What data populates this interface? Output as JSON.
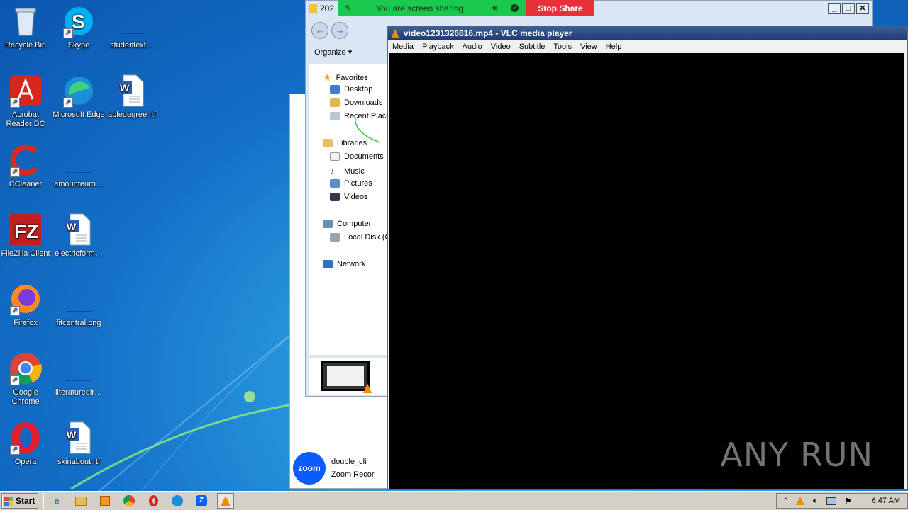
{
  "desktop": {
    "icons": [
      {
        "label": "Recycle Bin",
        "icon": "recycle-bin-icon"
      },
      {
        "label": "Skype",
        "icon": "skype-icon"
      },
      {
        "label": "studentext…",
        "icon": "file-icon"
      },
      {
        "label": "Acrobat Reader DC",
        "icon": "acrobat-icon"
      },
      {
        "label": "Microsoft Edge",
        "icon": "edge-icon"
      },
      {
        "label": "abledegree.rtf",
        "icon": "word-doc-icon"
      },
      {
        "label": "CCleaner",
        "icon": "ccleaner-icon"
      },
      {
        "label": "amounteuro…",
        "icon": "file-icon"
      },
      {
        "label": "FileZilla Client",
        "icon": "filezilla-icon"
      },
      {
        "label": "electricform…",
        "icon": "word-doc-icon"
      },
      {
        "label": "Firefox",
        "icon": "firefox-icon"
      },
      {
        "label": "fitcentral.png",
        "icon": "file-icon"
      },
      {
        "label": "Google Chrome",
        "icon": "chrome-icon"
      },
      {
        "label": "literaturedir…",
        "icon": "file-icon"
      },
      {
        "label": "Opera",
        "icon": "opera-icon"
      },
      {
        "label": "skinabout.rtf",
        "icon": "word-doc-icon"
      }
    ]
  },
  "share_bar": {
    "status": "You are screen sharing",
    "stop_label": "Stop Share"
  },
  "explorer": {
    "title": "202",
    "organize_label": "Organize",
    "nav": [
      {
        "label": "Favorites",
        "icon": "star-icon"
      },
      {
        "label": "Desktop",
        "icon": "desktop-icon"
      },
      {
        "label": "Downloads",
        "icon": "downloads-icon"
      },
      {
        "label": "Recent Places",
        "icon": "recent-places-icon"
      },
      {
        "label": "Libraries",
        "icon": "libraries-icon"
      },
      {
        "label": "Documents",
        "icon": "documents-icon"
      },
      {
        "label": "Music",
        "icon": "music-icon"
      },
      {
        "label": "Pictures",
        "icon": "pictures-icon"
      },
      {
        "label": "Videos",
        "icon": "videos-icon"
      },
      {
        "label": "Computer",
        "icon": "computer-icon"
      },
      {
        "label": "Local Disk (C:)",
        "icon": "disk-icon"
      },
      {
        "label": "Network",
        "icon": "network-icon"
      }
    ]
  },
  "bg_window": {
    "zoom_title": "double_cli",
    "zoom_sub": "Zoom Recor",
    "zoom_logo": "zoom"
  },
  "vlc": {
    "title": "video1231326616.mp4 - VLC media player",
    "menu": [
      "Media",
      "Playback",
      "Audio",
      "Video",
      "Subtitle",
      "Tools",
      "View",
      "Help"
    ],
    "watermark": "ANY RUN"
  },
  "taskbar": {
    "start_label": "Start",
    "clock": "6:47 AM"
  },
  "colors": {
    "share_green": "#1bc94e",
    "stop_red": "#e8303a",
    "vlc_title": "#1f3c72"
  }
}
